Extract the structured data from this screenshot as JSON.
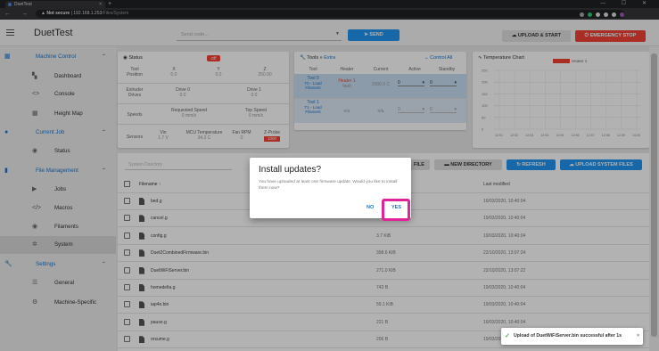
{
  "browser": {
    "tab_title": "DuetTest",
    "tab_close": "×",
    "new_tab": "+",
    "nav_buttons": "← → C",
    "security_label": "Not secure",
    "url_host": "192.168.1.253",
    "url_path": "/Files/System",
    "window_controls": "— ☐ ✕"
  },
  "app": {
    "title": "DuetTest",
    "code_placeholder": "Send code...",
    "send_label": "SEND",
    "upload_label": "UPLOAD & START",
    "emergency_label": "EMERGENCY STOP"
  },
  "sidebar": {
    "groups": [
      {
        "label": "Machine Control",
        "icon": "machine-icon",
        "items": [
          {
            "label": "Dashboard",
            "icon": "dashboard-icon"
          },
          {
            "label": "Console",
            "icon": "console-icon"
          },
          {
            "label": "Height Map",
            "icon": "heightmap-icon"
          }
        ]
      },
      {
        "label": "Current Job",
        "icon": "job-icon",
        "items": [
          {
            "label": "Status",
            "icon": "status-icon"
          }
        ]
      },
      {
        "label": "File Management",
        "icon": "file-icon",
        "items": [
          {
            "label": "Jobs",
            "icon": "play-icon"
          },
          {
            "label": "Macros",
            "icon": "code-icon"
          },
          {
            "label": "Filaments",
            "icon": "filament-icon"
          },
          {
            "label": "System",
            "icon": "gear-icon"
          }
        ]
      },
      {
        "label": "Settings",
        "icon": "wrench-icon",
        "items": [
          {
            "label": "General",
            "icon": "sliders-icon"
          },
          {
            "label": "Machine-Specific",
            "icon": "cogs-icon"
          }
        ]
      }
    ]
  },
  "status": {
    "title": "Status",
    "state": "Off",
    "tool_label": "Tool",
    "position_label": "Position",
    "axes": [
      {
        "name": "X",
        "value": "0.0"
      },
      {
        "name": "Y",
        "value": "0.0"
      },
      {
        "name": "Z",
        "value": "250.00"
      }
    ],
    "extruder_label": "Extruder",
    "drives_label": "Drives",
    "drive0": "Drive 0",
    "drive0_val": "0.0",
    "drive1": "Drive 1",
    "drive1_val": "0.0",
    "speeds_label": "Speeds",
    "req_speed": "Requested Speed",
    "req_speed_val": "0 mm/s",
    "top_speed": "Top Speed",
    "top_speed_val": "0 mm/s",
    "sensors_label": "Sensors",
    "vin": "Vin",
    "vin_val": "1.7 V",
    "mcu": "MCU Temperature",
    "mcu_val": "34.2 C",
    "fan": "Fan RPM",
    "fan_val": "0",
    "zprobe": "Z-Probe",
    "zprobe_val": "1000"
  },
  "tools": {
    "title": "Tools",
    "extra": "Extra",
    "control_all": "Control All",
    "headers": [
      "Tool",
      "Heater",
      "Current",
      "Active",
      "Standby"
    ],
    "rows": [
      {
        "tool": "Tool 0",
        "sub": "T0 - Load Filament",
        "heater": "Heater 1",
        "heater_sub": "fault",
        "current": "2000.0 C",
        "active": "0",
        "standby": "0"
      },
      {
        "tool": "Tool 1",
        "sub": "T1 - Load Filament",
        "heater": "n/a",
        "heater_sub": "",
        "current": "n/a",
        "active": "0",
        "standby": "0"
      }
    ]
  },
  "temp_chart": {
    "title": "Temperature Chart",
    "legend": "Heater 1",
    "y_ticks": [
      "250",
      "200",
      "150",
      "100",
      "50",
      "0"
    ],
    "x_ticks": [
      "12:51",
      "12:52",
      "12:53",
      "12:54",
      "12:55",
      "12:56",
      "12:57",
      "12:58",
      "12:59",
      "14:00"
    ]
  },
  "files": {
    "search_placeholder": "System Directory",
    "new_file": "FILE",
    "new_directory": "NEW DIRECTORY",
    "refresh": "REFRESH",
    "upload_system": "UPLOAD SYSTEM FILES",
    "col_filename": "Filename ↑",
    "col_modified": "Last modified",
    "rows": [
      {
        "name": "bed.g",
        "size": "",
        "date": "19/03/2020, 10:40:04"
      },
      {
        "name": "cancel.g",
        "size": "",
        "date": "19/03/2020, 10:40:04"
      },
      {
        "name": "config.g",
        "size": "3.7 KiB",
        "date": "19/03/2020, 10:40:04"
      },
      {
        "name": "Duet2CombinedFirmware.bin",
        "size": "398.6 KiB",
        "date": "22/10/2020, 13:07:24"
      },
      {
        "name": "DuetWiFiServer.bin",
        "size": "271.0 KiB",
        "date": "22/10/2020, 13:07:22"
      },
      {
        "name": "homedelta.g",
        "size": "743 B",
        "date": "19/03/2020, 10:40:04"
      },
      {
        "name": "iap4e.bin",
        "size": "59.1 KiB",
        "date": "19/03/2020, 10:40:04"
      },
      {
        "name": "pause.g",
        "size": "221 B",
        "date": "19/03/2020, 10:40:04"
      },
      {
        "name": "resume.g",
        "size": "206 B",
        "date": "19/03/2020, 10:40:04"
      },
      {
        "name": "sleep.g",
        "size": "54 B",
        "date": "19/03/2020, 10:40:04"
      }
    ]
  },
  "dialog": {
    "title": "Install updates?",
    "message": "You have uploaded at least one firmware update. Would you like to install them now?",
    "no": "NO",
    "yes": "YES"
  },
  "toast": {
    "message": "Upload of DuetWiFiServer.bin successful after 1s",
    "close": "×"
  },
  "colors": {
    "primary": "#2196f3",
    "danger": "#f44336",
    "highlight": "#e0239a",
    "success": "#4caf50"
  }
}
